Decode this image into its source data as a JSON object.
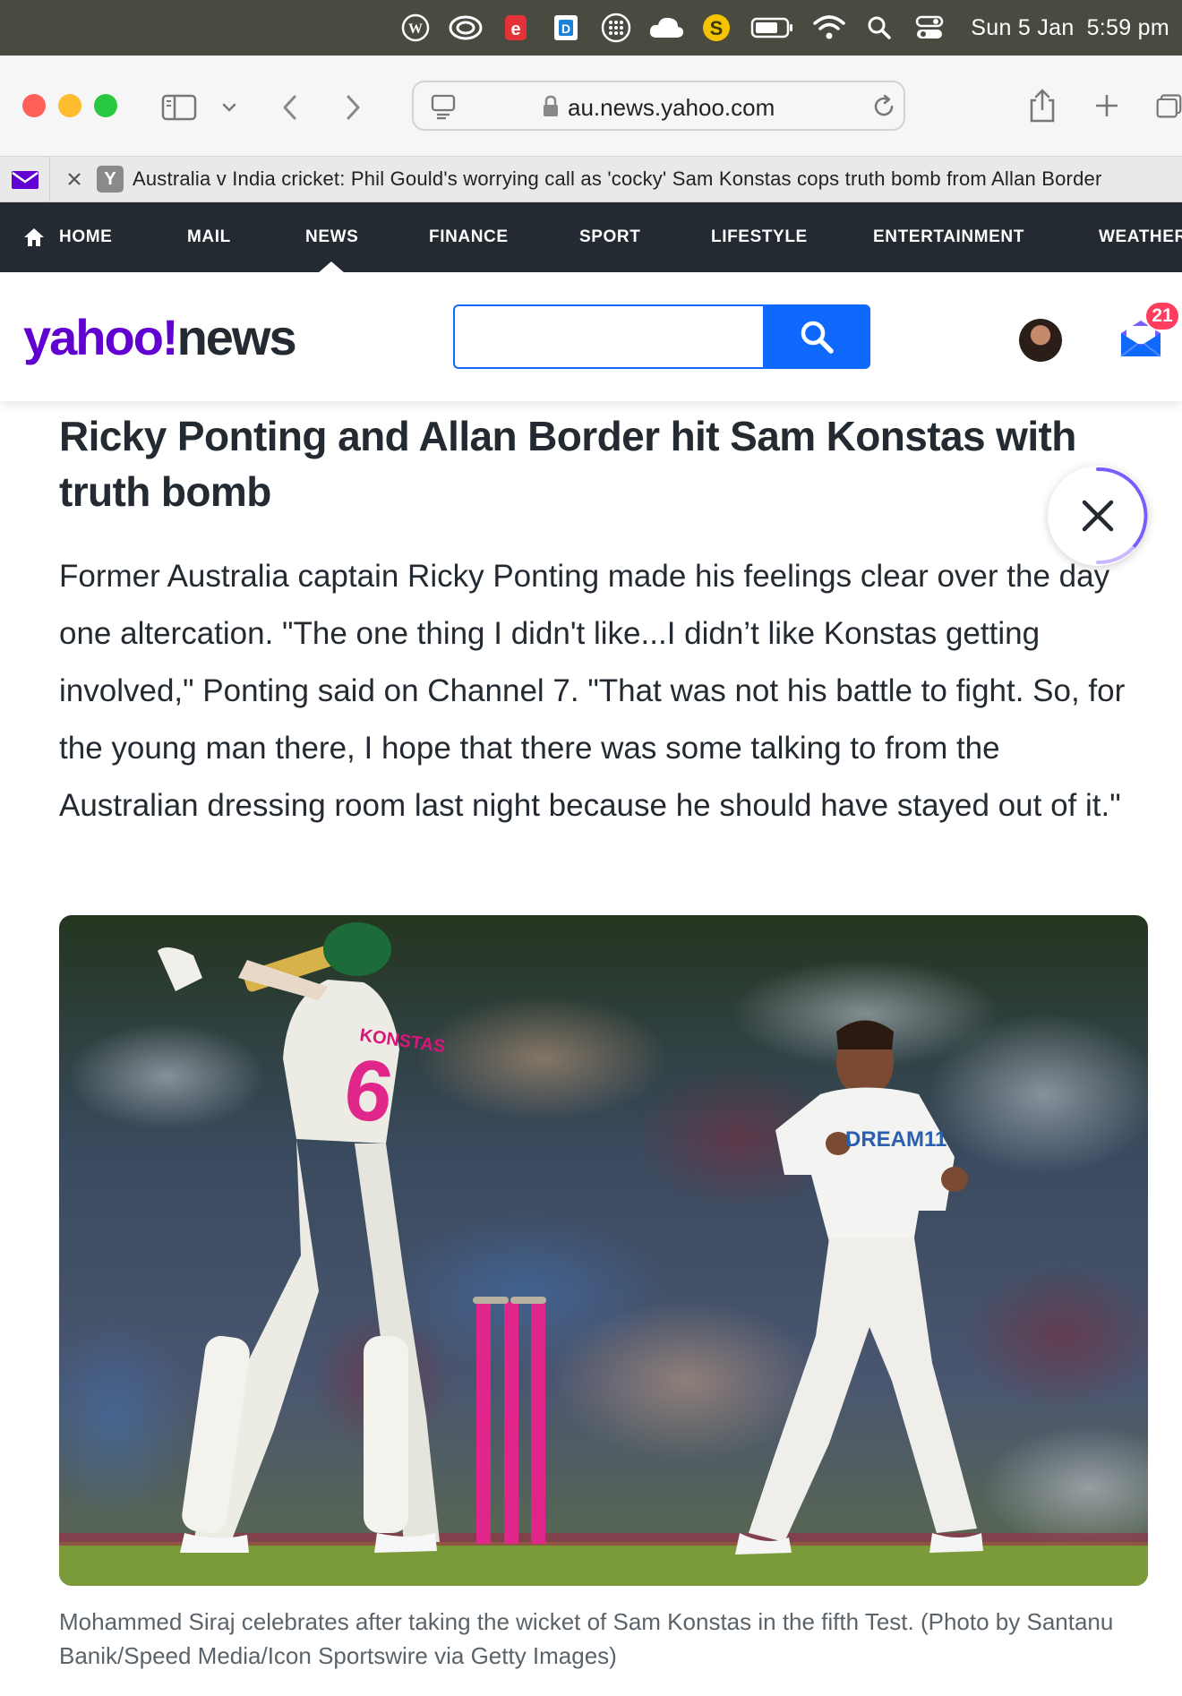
{
  "menubar": {
    "date": "Sun 5 Jan",
    "time": "5:59 pm",
    "icons": [
      "wordpress-icon",
      "creative-cloud-icon",
      "ebay-icon",
      "dashlane-icon",
      "grid-icon",
      "cloud-icon",
      "sketch-icon",
      "battery-icon",
      "wifi-icon",
      "spotlight-icon",
      "control-center-icon"
    ]
  },
  "browser": {
    "url": "au.news.yahoo.com",
    "tab_title": "Australia v India cricket: Phil Gould's worrying call as 'cocky' Sam Konstas cops truth bomb from Allan Border",
    "tab_favicon": "Y"
  },
  "nav": {
    "items": [
      "HOME",
      "MAIL",
      "NEWS",
      "FINANCE",
      "SPORT",
      "LIFESTYLE",
      "ENTERTAINMENT",
      "WEATHER"
    ],
    "active": "NEWS"
  },
  "header": {
    "logo_yahoo": "yahoo!",
    "logo_news": "news",
    "search_placeholder": "",
    "mail_badge": "21"
  },
  "article": {
    "headline": "Ricky Ponting and Allan Border hit Sam Konstas with truth bomb",
    "body": "Former Australia captain Ricky Ponting made his feelings clear over the day one altercation. \"The one thing I didn't like...I didn’t like Konstas getting involved,\" Ponting said on Channel 7. \"That was not his battle to fight. So, for the young man there, I hope that there was some talking to from the Australian dressing room last night because he should have stayed out of it.\"",
    "photo_caption": "Mohammed Siraj celebrates after taking the wicket of Sam Konstas in the fifth Test. (Photo by Santanu Banik/Speed Media/Icon Sportswire via Getty Images)",
    "jersey_name": "KONSTAS",
    "jersey_number": "6",
    "shirt_sponsor": "DREAM11"
  }
}
